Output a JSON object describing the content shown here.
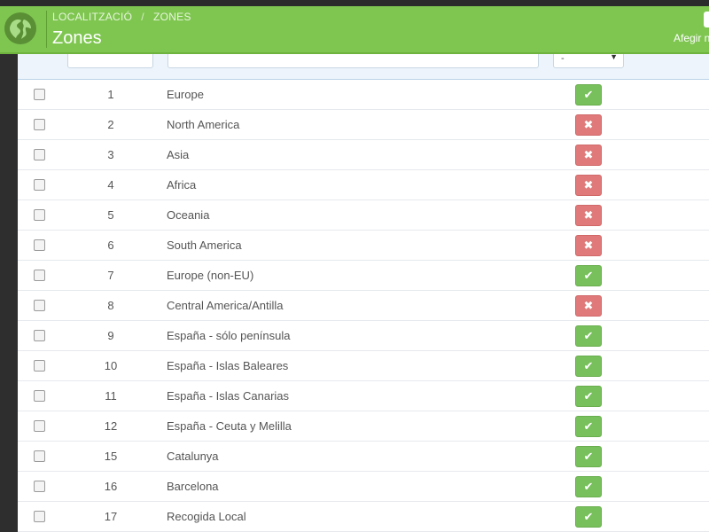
{
  "header": {
    "breadcrumb": [
      "LOCALITZACIÓ",
      "ZONES"
    ],
    "breadcrumb_separator": "/",
    "title": "Zones",
    "add_label": "Afegir n",
    "colors": {
      "header_bg": "#7fc651",
      "enabled": "#78c05c",
      "disabled": "#e07a7a"
    }
  },
  "filters": {
    "status_select_value": "-"
  },
  "icons": {
    "logo": "globe-icon",
    "enabled": "check-icon",
    "disabled": "cross-icon",
    "select_caret": "caret-down-icon"
  },
  "zones": [
    {
      "id": "1",
      "name": "Europe",
      "enabled": true
    },
    {
      "id": "2",
      "name": "North America",
      "enabled": false
    },
    {
      "id": "3",
      "name": "Asia",
      "enabled": false
    },
    {
      "id": "4",
      "name": "Africa",
      "enabled": false
    },
    {
      "id": "5",
      "name": "Oceania",
      "enabled": false
    },
    {
      "id": "6",
      "name": "South America",
      "enabled": false
    },
    {
      "id": "7",
      "name": "Europe (non-EU)",
      "enabled": true
    },
    {
      "id": "8",
      "name": "Central America/Antilla",
      "enabled": false
    },
    {
      "id": "9",
      "name": "España - sólo península",
      "enabled": true
    },
    {
      "id": "10",
      "name": "España - Islas Baleares",
      "enabled": true
    },
    {
      "id": "11",
      "name": "España - Islas Canarias",
      "enabled": true
    },
    {
      "id": "12",
      "name": "España - Ceuta y Melilla",
      "enabled": true
    },
    {
      "id": "15",
      "name": "Catalunya",
      "enabled": true
    },
    {
      "id": "16",
      "name": "Barcelona",
      "enabled": true
    },
    {
      "id": "17",
      "name": "Recogida Local",
      "enabled": true
    }
  ]
}
